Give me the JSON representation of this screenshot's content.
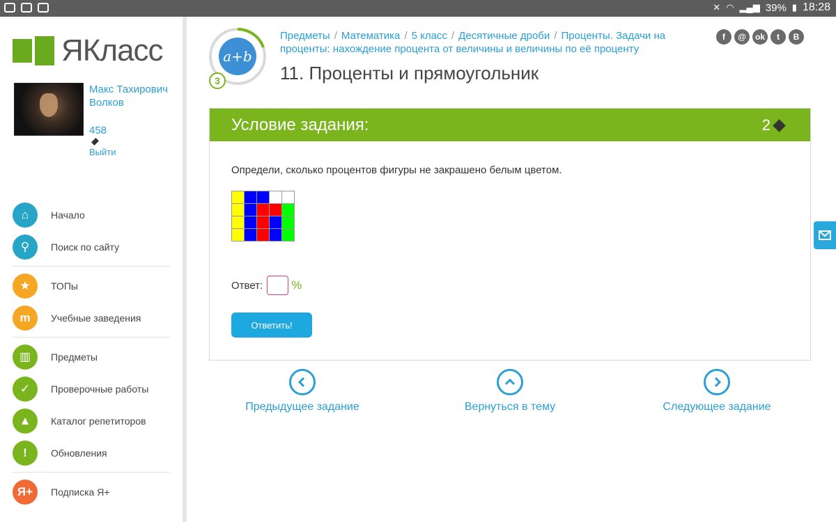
{
  "statusbar": {
    "battery": "39%",
    "time": "18:28"
  },
  "sidebar": {
    "logo_text": "ЯКласс",
    "user": {
      "name": "Макс Тахирович Волков",
      "points": "458",
      "logout": "Выйти"
    },
    "menu": [
      {
        "label": "Начало",
        "icon": "home-icon",
        "glyph": "⌂",
        "color": "#26a5c7"
      },
      {
        "label": "Поиск по сайту",
        "icon": "search-icon",
        "glyph": "⚲",
        "color": "#26a5c7"
      },
      {
        "label": "ТОПы",
        "icon": "star-icon",
        "glyph": "★",
        "color": "#f5a623"
      },
      {
        "label": "Учебные заведения",
        "icon": "school-icon",
        "glyph": "m",
        "color": "#f5a623"
      },
      {
        "label": "Предметы",
        "icon": "book-icon",
        "glyph": "▥",
        "color": "#7ab51d"
      },
      {
        "label": "Проверочные работы",
        "icon": "check-icon",
        "glyph": "✓",
        "color": "#7ab51d"
      },
      {
        "label": "Каталог репетиторов",
        "icon": "graduation-cap-icon",
        "glyph": "▲",
        "color": "#7ab51d"
      },
      {
        "label": "Обновления",
        "icon": "exclamation-icon",
        "glyph": "!",
        "color": "#7ab51d"
      },
      {
        "label": "Подписка Я+",
        "icon": "ya-plus-icon",
        "glyph": "Я+",
        "color": "#f06a36"
      }
    ]
  },
  "topic": {
    "symbol": "a+b",
    "level": "3",
    "breadcrumb": [
      "Предметы",
      "Математика",
      "5 класс",
      "Десятичные дроби",
      "Проценты. Задачи на проценты: нахождение процента от величины и величины по её проценту"
    ],
    "title": "11. Проценты и прямоугольник"
  },
  "social": [
    {
      "icon": "facebook-icon",
      "glyph": "f"
    },
    {
      "icon": "mail-ru-icon",
      "glyph": "@"
    },
    {
      "icon": "odnoklassniki-icon",
      "glyph": "ok"
    },
    {
      "icon": "twitter-icon",
      "glyph": "t"
    },
    {
      "icon": "vkontakte-icon",
      "glyph": "В"
    }
  ],
  "task": {
    "header": "Условие задания:",
    "points": "2",
    "question": "Определи, сколько процентов фигуры не закрашено белым цветом.",
    "grid": [
      [
        "#ffff00",
        "#0000ff",
        "#0000ff",
        "#ffffff",
        "#ffffff"
      ],
      [
        "#ffff00",
        "#0000ff",
        "#ff0000",
        "#ff0000",
        "#00ff00"
      ],
      [
        "#ffff00",
        "#0000ff",
        "#ff0000",
        "#0000ff",
        "#00ff00"
      ],
      [
        "#ffff00",
        "#0000ff",
        "#ff0000",
        "#0000ff",
        "#00ff00"
      ]
    ],
    "answer_label": "Ответ:",
    "answer_value": "",
    "unit": "%",
    "submit_label": "Ответить!"
  },
  "navigation": {
    "prev": "Предыдущее задание",
    "up": "Вернуться в тему",
    "next": "Следующее задание"
  },
  "colors": {
    "brand_green": "#7ab51d",
    "link_blue": "#2a9fd6",
    "button_blue": "#1ea8e0"
  }
}
